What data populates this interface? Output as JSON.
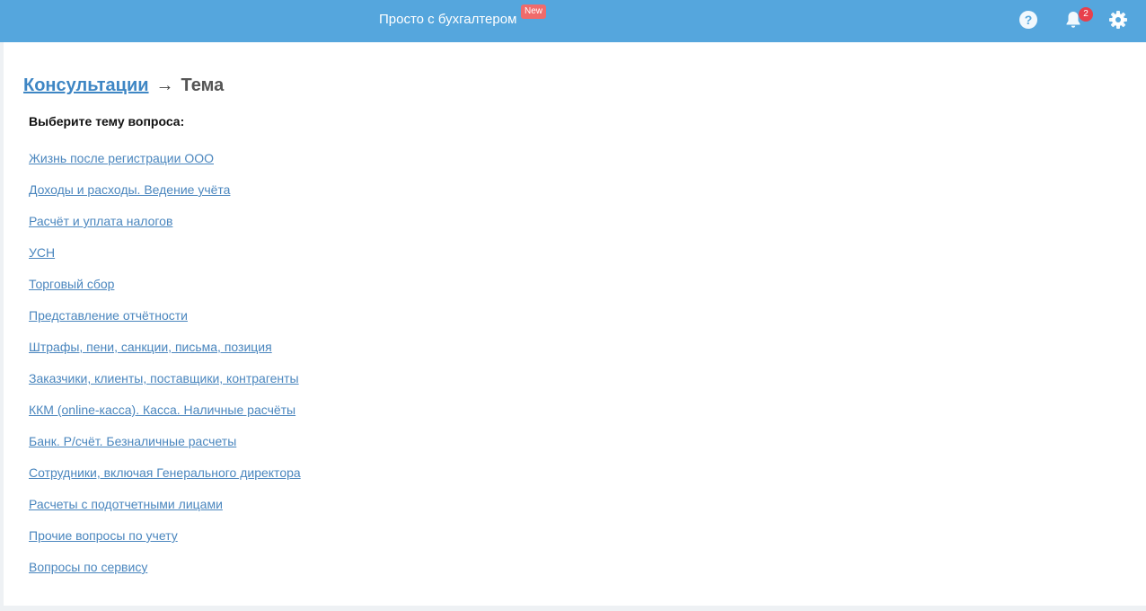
{
  "header": {
    "brand_label": "Просто с бухгалтером",
    "new_badge": "New",
    "help_icon": "question-circle-icon",
    "bell_icon": "bell-icon",
    "notifications_count": "2",
    "settings_icon": "gear-icon",
    "bar_color": "#55a6dd"
  },
  "breadcrumb": {
    "parent": "Консультации",
    "separator": "→",
    "current": "Тема"
  },
  "prompt": "Выберите тему вопроса:",
  "topics": [
    "Жизнь после регистрации ООО",
    "Доходы и расходы. Ведение учёта",
    "Расчёт и уплата налогов",
    "УСН",
    "Торговый сбор",
    "Представление отчётности",
    "Штрафы, пени, санкции, письма, позиция",
    "Заказчики, клиенты, поставщики, контрагенты",
    "ККМ (online-касса). Касса. Наличные расчёты",
    "Банк. Р/счёт. Безналичные расчеты",
    "Сотрудники, включая Генерального директора",
    "Расчеты с подотчетными лицами",
    "Прочие вопросы по учету",
    "Вопросы по сервису"
  ]
}
